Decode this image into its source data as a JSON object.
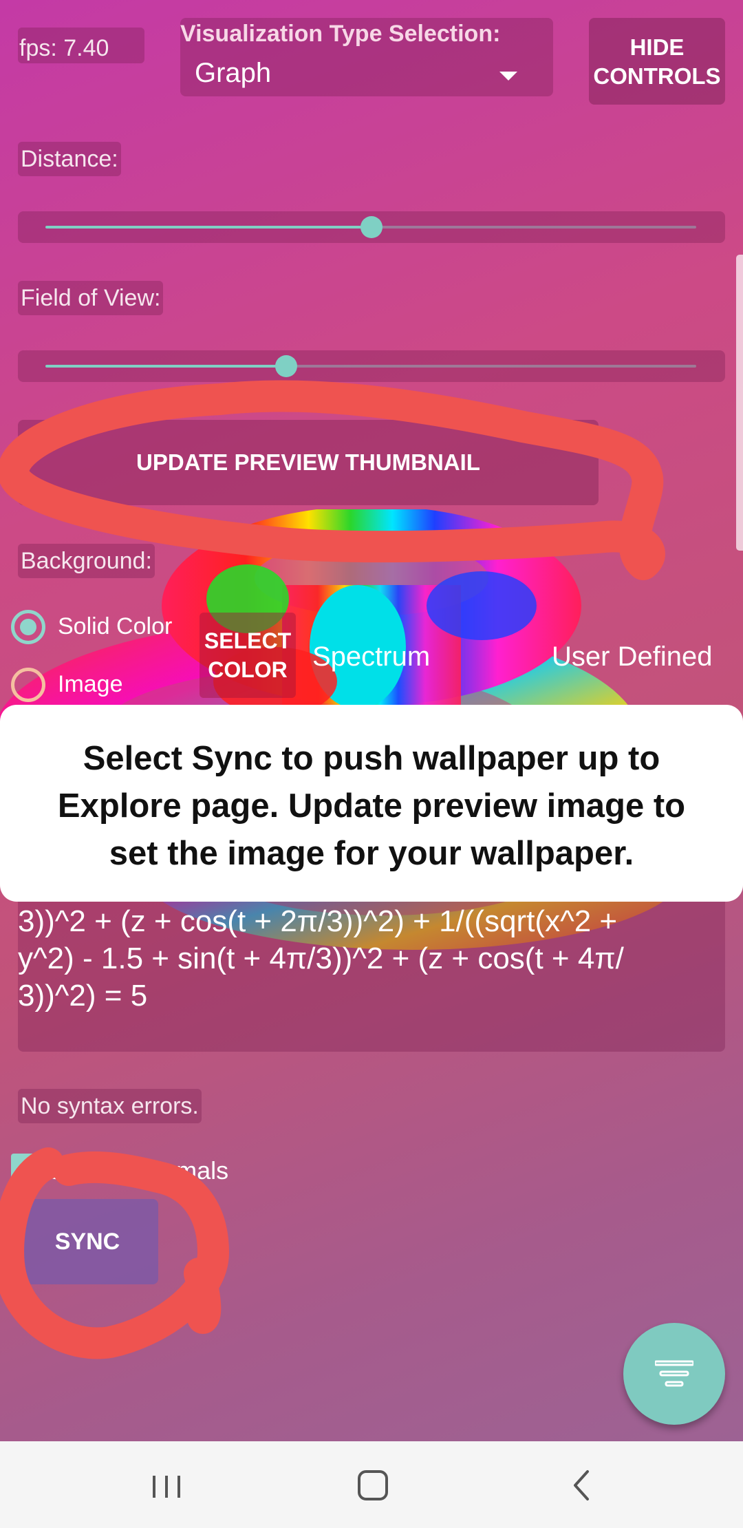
{
  "header": {
    "fps_label": "fps: 7.40",
    "viz_title": "Visualization Type Selection:",
    "viz_value": "Graph",
    "hide_controls_label": "HIDE\nCONTROLS"
  },
  "distance": {
    "label": "Distance:",
    "value_fraction": 0.5
  },
  "field_of_view": {
    "label": "Field of View:",
    "value_fraction": 0.37
  },
  "update_preview_label": "UPDATE PREVIEW THUMBNAIL",
  "background": {
    "label": "Background:",
    "options": [
      {
        "label": "Solid Color",
        "selected": true
      },
      {
        "label": "Image",
        "selected": false
      }
    ],
    "select_color_label": "SELECT\nCOLOR"
  },
  "color_tabs": [
    "Spectrum",
    "User Defined"
  ],
  "toast": {
    "line1": "Select Sync to push wallpaper up to",
    "line2": "Explore page. Update preview image to",
    "line3": "set the image for your wallpaper."
  },
  "equation": {
    "lines": [
      "3))^2 + (z + cos(t + 2π/3))^2) + 1/((sqrt(x^2 +",
      "y^2) - 1.5 + sin(t + 4π/3))^2 + (z + cos(t + 4π/",
      "3))^2) = 5"
    ]
  },
  "syntax_status": "No syntax errors.",
  "normals_label": "Smooth normals",
  "sync_label": "SYNC",
  "fab": {
    "icon": "sort-icon"
  },
  "navbar": {
    "recents_icon": "recents-icon",
    "home_icon": "home-icon",
    "back_icon": "back-icon"
  },
  "colors": {
    "accent": "#7fd0c4",
    "annotation_red": "#ef5350",
    "toast_bg": "#ffffff"
  }
}
